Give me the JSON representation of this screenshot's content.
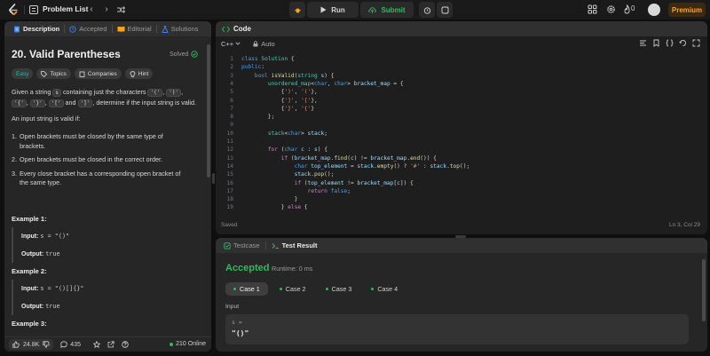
{
  "topbar": {
    "title": "Problem List",
    "run_label": "Run",
    "submit_label": "Submit",
    "streak_count": "0",
    "premium_label": "Premium"
  },
  "left": {
    "tabs": [
      {
        "label": "Description",
        "icon": "doc-icon"
      },
      {
        "label": "Accepted",
        "icon": "clock-icon"
      },
      {
        "label": "Editorial",
        "icon": "book-icon"
      },
      {
        "label": "Solutions",
        "icon": "flask-icon"
      }
    ],
    "title": "20. Valid Parentheses",
    "solved_label": "Solved",
    "tags": [
      "Easy",
      "Topics",
      "Companies",
      "Hint"
    ],
    "desc": {
      "p1a": "Given a string ",
      "p1_s": "s",
      "p1b": " containing just the characters ",
      "c1": "'('",
      "c2": "')'",
      "c3": "'{'",
      "c4": "'}'",
      "c5": "'['",
      "and": " and ",
      "c6": "']'",
      "p1c": ", determine if the input string is valid.",
      "p2": "An input string is valid if:",
      "li1": "Open brackets must be closed by the same type of brackets.",
      "li2": "Open brackets must be closed in the correct order.",
      "li3": "Every close bracket has a corresponding open bracket of the same type."
    },
    "examples": [
      {
        "title": "Example 1:",
        "input_label": "Input:",
        "input": "s = \"()\"",
        "output_label": "Output:",
        "output": "true"
      },
      {
        "title": "Example 2:",
        "input_label": "Input:",
        "input": "s = \"()[]{}\"",
        "output_label": "Output:",
        "output": "true"
      },
      {
        "title": "Example 3:"
      }
    ],
    "bottom": {
      "likes": "24.8K",
      "comments": "435",
      "online": "210 Online"
    }
  },
  "code": {
    "header": "Code",
    "lang": "C++",
    "mode": "Auto",
    "status": "Saved",
    "cursor": "Ln 3, Col 29"
  },
  "result": {
    "tabs": [
      "Testcase",
      "Test Result"
    ],
    "status": "Accepted",
    "runtime": "Runtime: 0 ms",
    "cases": [
      "Case 1",
      "Case 2",
      "Case 3",
      "Case 4"
    ],
    "input_label": "Input",
    "var": "s =",
    "value": "\"()\""
  },
  "colors": {
    "accent_green": "#2cbb5d",
    "premium": "#ffa116",
    "easy": "#1cbaba"
  }
}
